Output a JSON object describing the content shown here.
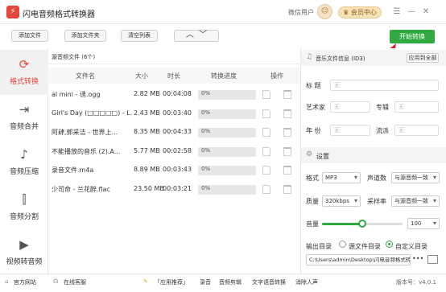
{
  "app": {
    "title": "闪电音频格式转换器",
    "user": "微信用户",
    "vip": "会员中心"
  },
  "toolbar": {
    "add_file": "添加文件",
    "add_folder": "添加文件夹",
    "clear_list": "清空列表",
    "start": "开始转换"
  },
  "nav": [
    {
      "label": "格式转换",
      "icon": "refresh-icon",
      "active": true
    },
    {
      "label": "音频合并",
      "icon": "merge-icon"
    },
    {
      "label": "音频压缩",
      "icon": "compress-icon"
    },
    {
      "label": "音频分割",
      "icon": "split-icon"
    },
    {
      "label": "视频转音频",
      "icon": "video-icon"
    }
  ],
  "list": {
    "header": "源音频文件 (6个)",
    "columns": {
      "name": "文件名",
      "size": "大小",
      "duration": "时长",
      "progress": "转换进度",
      "action": "操作"
    },
    "rows": [
      {
        "name": "al mini - 诱.ogg",
        "size": "2.82 MB",
        "duration": "00:04:08",
        "progress": "0%"
      },
      {
        "name": "Girl's Day (□□□□□) - L...",
        "size": "2.43 MB",
        "duration": "00:03:40",
        "progress": "0%"
      },
      {
        "name": "阿肆,郭采洁 - 世界上...",
        "size": "8.35 MB",
        "duration": "00:04:33",
        "progress": "0%"
      },
      {
        "name": "不能播放的音乐 (2).A...",
        "size": "5.77 MB",
        "duration": "00:02:58",
        "progress": "0%"
      },
      {
        "name": "录音文件.m4a",
        "size": "8.89 MB",
        "duration": "00:03:43",
        "progress": "0%"
      },
      {
        "name": "少司命 - 兰花醉.flac",
        "size": "23.50 MB",
        "duration": "00:03:21",
        "progress": "0%"
      }
    ]
  },
  "meta": {
    "header": "音乐文件信息 (ID3)",
    "apply_all": "应用到全部",
    "title_label": "标  题",
    "artist_label": "艺术家",
    "album_label": "专辑",
    "year_label": "年  份",
    "genre_label": "流派",
    "placeholder": "无"
  },
  "settings": {
    "header": "设置",
    "format_label": "格式",
    "format_value": "MP3",
    "channel_label": "声道数",
    "channel_value": "与源音频一致",
    "quality_label": "质量",
    "quality_value": "320kbps",
    "samplerate_label": "采样率",
    "samplerate_value": "与源音频一致",
    "volume_label": "音量",
    "volume_value": "100",
    "volume_level": 0.5,
    "outdir_label": "输出目录",
    "source_dir": "源文件目录",
    "custom_dir": "自定义目录",
    "path": "C:\\Users\\admin\\Desktop\\闪电音频格式转"
  },
  "footer": {
    "website": "官方网站",
    "support": "在线客服",
    "recommend": "「应用推荐」",
    "links": [
      "录音",
      "音频剪辑",
      "文字语音转换",
      "消除人声"
    ],
    "version": "版本号：v4.0.1"
  },
  "colors": {
    "accent": "#e8453c",
    "start": "#2fa940",
    "slider": "#2fa940"
  }
}
